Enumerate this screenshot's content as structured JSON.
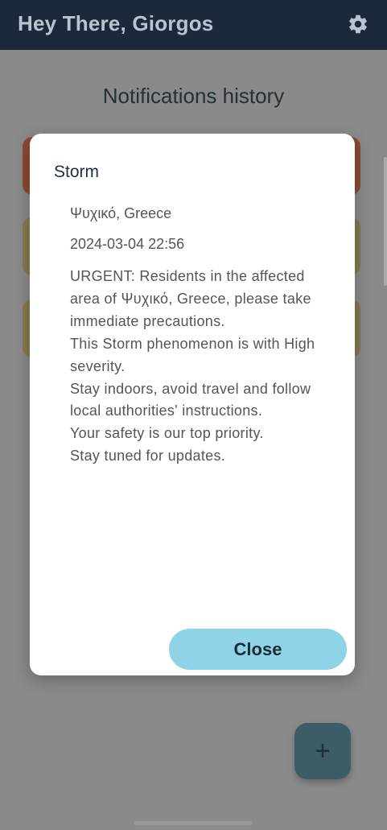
{
  "appbar": {
    "greeting": "Hey There, Giorgos",
    "settings_icon": "gear-icon"
  },
  "screen": {
    "heading": "Notifications history",
    "fab_label": "+"
  },
  "colors": {
    "appbar": "#1a2a3a",
    "card_storm": "#8b4a32",
    "card_other": "#857a4f",
    "close_button": "#8ed4e6"
  },
  "dialog": {
    "title": "Storm",
    "location": "Ψυχικό, Greece",
    "datetime": "2024-03-04 22:56",
    "message": "URGENT: Residents in the affected area of Ψυχικό, Greece, please take immediate precautions.\nThis Storm phenomenon is with High severity.\nStay indoors, avoid travel and follow local authorities' instructions.\nYour safety is our top priority.\nStay tuned for updates.",
    "close_label": "Close"
  }
}
